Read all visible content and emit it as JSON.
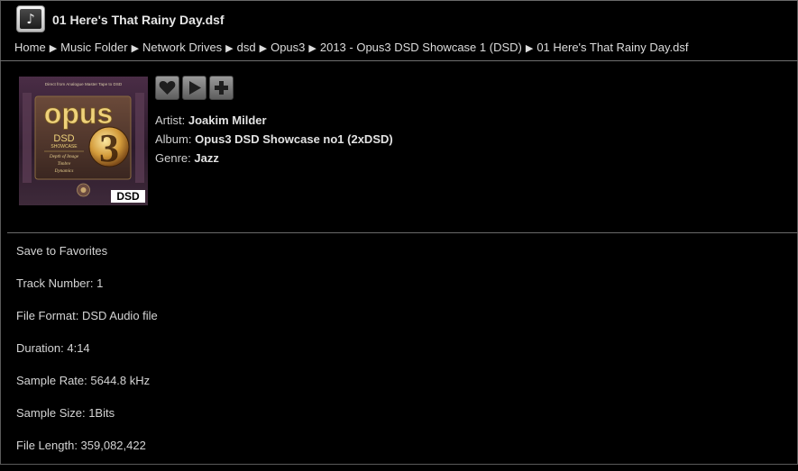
{
  "header": {
    "title": "01 Here's That Rainy Day.dsf",
    "app_icon": "music-note-icon"
  },
  "breadcrumb": {
    "items": [
      "Home",
      "Music Folder",
      "Network Drives",
      "dsd",
      "Opus3",
      "2013 - Opus3 DSD Showcase 1 (DSD)",
      "01 Here's That Rainy Day.dsf"
    ],
    "separator": "▶"
  },
  "album_art": {
    "top_text": "Direct from Analogue Master Tape to DSD",
    "brand": "opus",
    "badge_number": "3",
    "subtitle_1": "DSD",
    "subtitle_2": "SHOWCASE",
    "line_1": "Depth of Image",
    "line_2": "Timbre",
    "line_3": "Dynamics",
    "corner_logo": "DSD"
  },
  "actions": {
    "icons": [
      "heart-icon",
      "play-icon",
      "plus-icon"
    ]
  },
  "metadata": {
    "artist_label": "Artist:",
    "artist": "Joakim Milder",
    "album_label": "Album:",
    "album": "Opus3 DSD Showcase no1 (2xDSD)",
    "genre_label": "Genre:",
    "genre": "Jazz"
  },
  "details": {
    "save_favorites": "Save to Favorites",
    "track_number": "Track Number: 1",
    "file_format": "File Format: DSD Audio file",
    "duration": "Duration: 4:14",
    "sample_rate": "Sample Rate: 5644.8 kHz",
    "sample_size": "Sample Size: 1Bits",
    "file_length": "File Length: 359,082,422"
  },
  "colors": {
    "background": "#000000",
    "text": "#d8d8d8",
    "divider": "#6a6a6a",
    "button": "#7a7a7a",
    "album_gold": "#e8c867"
  }
}
